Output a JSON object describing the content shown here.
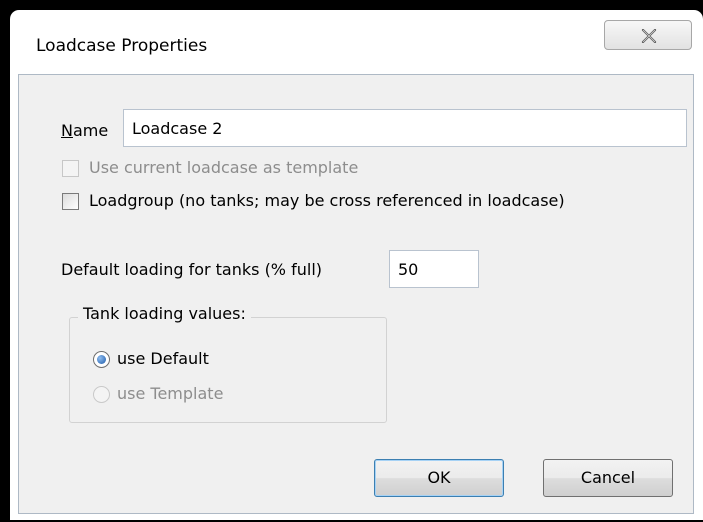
{
  "dialog": {
    "title": "Loadcase Properties",
    "close_icon": "close-icon"
  },
  "form": {
    "name_label_accel": "N",
    "name_label_rest": "ame",
    "name_value": "Loadcase 2",
    "use_template_label": "Use current loadcase as template",
    "use_template_checked": false,
    "use_template_enabled": false,
    "loadgroup_label": "Loadgroup (no tanks; may be cross referenced in loadcase)",
    "loadgroup_checked": false,
    "default_loading_label": "Default loading for tanks (% full)",
    "default_loading_value": "50"
  },
  "tank_loading": {
    "legend": "Tank loading values:",
    "options": [
      {
        "label": "use Default",
        "selected": true,
        "enabled": true
      },
      {
        "label": "use Template",
        "selected": false,
        "enabled": false
      }
    ]
  },
  "buttons": {
    "ok_label": "OK",
    "cancel_label": "Cancel"
  },
  "colors": {
    "window_bg": "#ffffff",
    "client_bg": "#f0f0f0",
    "disabled_text": "#8d8d8d",
    "radio_selected": "#1d5aa8"
  }
}
